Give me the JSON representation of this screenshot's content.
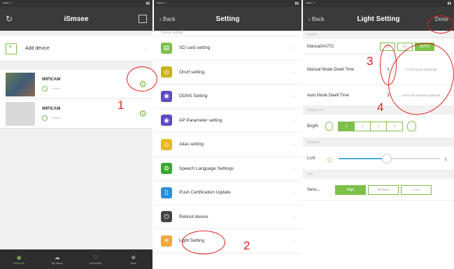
{
  "panel1": {
    "title": "iSmsee",
    "add_device": "Add device",
    "cameras": [
      {
        "name": "WIFICAM",
        "status": "on line"
      },
      {
        "name": "WIFICAM",
        "status": "Off line"
      }
    ],
    "tabs": [
      "Device list",
      "My Videos",
      "Event Alert",
      "More"
    ]
  },
  "panel2": {
    "back": "Back",
    "title": "Setting",
    "cut_item": "Device setting",
    "items": [
      {
        "label": "SD card setting",
        "color": "#7cc04a",
        "icon": "sd-card-icon"
      },
      {
        "label": "Onvif setting",
        "color": "#c9b21e",
        "icon": "onvif-icon"
      },
      {
        "label": "DDNS Setting",
        "color": "#5b4cc4",
        "icon": "ddns-icon"
      },
      {
        "label": "AP Parameter setting",
        "color": "#5b4cc4",
        "icon": "wifi-icon"
      },
      {
        "label": "Alias setting",
        "color": "#e8b822",
        "icon": "alias-icon"
      },
      {
        "label": "Speech Language Settings",
        "color": "#3aa832",
        "icon": "speech-icon"
      },
      {
        "label": "Push Certification Update",
        "color": "#2b8fd6",
        "icon": "push-icon"
      },
      {
        "label": "Reboot device",
        "color": "#444444",
        "icon": "reboot-icon"
      },
      {
        "label": "Light Setting",
        "color": "#f2a93b",
        "icon": "light-bulb-icon"
      }
    ]
  },
  "panel3": {
    "back": "Back",
    "title": "Light Setting",
    "done": "Done",
    "switch_head": "Switch",
    "manual_auto": "Manual/AUTO",
    "segments": [
      "Off",
      "On",
      "AUTO"
    ],
    "manual_dwell": "Manual Mode Dwell Time",
    "manual_dwell_value": "1",
    "manual_hint": "1/1-10 hours (optional)",
    "auto_dwell": "Auto Mode Dwell Time",
    "auto_dwell_value": "3",
    "auto_hint": "min/1-30 minutes (optional)",
    "brightness_head": "Brightness",
    "bright": "Bright",
    "bright_levels": [
      "1",
      "2",
      "3",
      "4"
    ],
    "bright_level": 1,
    "daylight_head": "Daylight",
    "lux": "LUX",
    "lux_level": 0.48,
    "pir_head": "PIR",
    "sens": "Sens...",
    "sens_segments": [
      "High",
      "Medium",
      "Low"
    ]
  },
  "annotations": [
    "1",
    "2",
    "3",
    "4"
  ],
  "accent": "#7cc04a"
}
